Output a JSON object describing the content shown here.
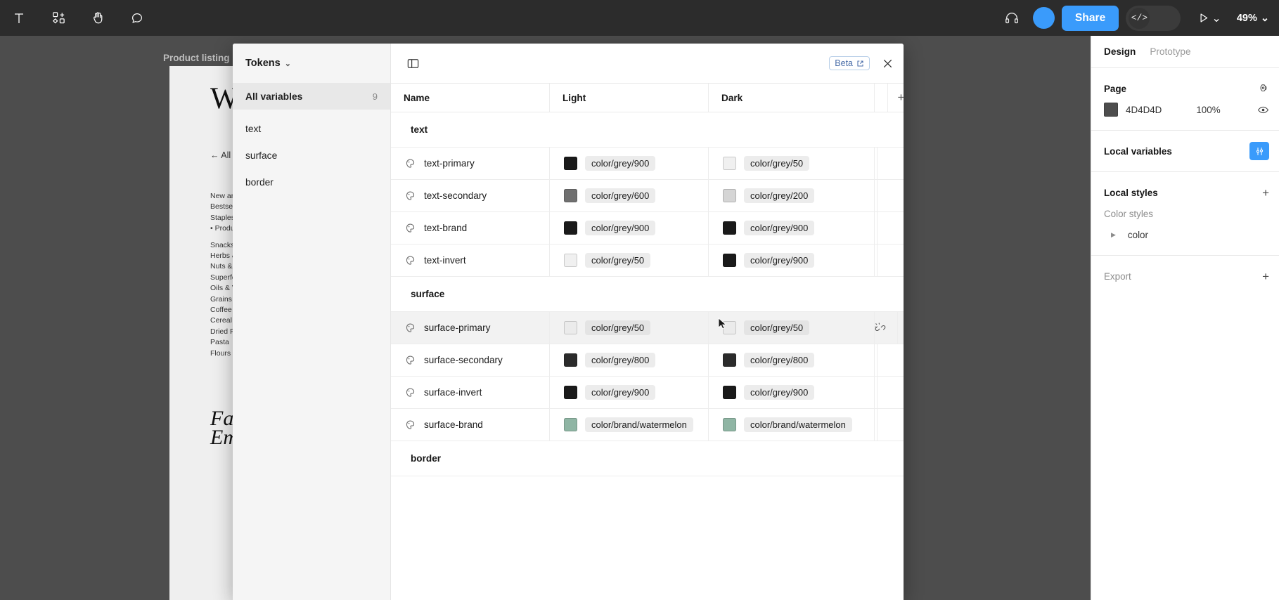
{
  "toolbar": {
    "left_tools": [
      {
        "name": "text-tool-icon",
        "glyph": "T"
      },
      {
        "name": "components-tool-icon",
        "glyph": "components"
      },
      {
        "name": "hand-tool-icon",
        "glyph": "hand"
      },
      {
        "name": "comment-tool-icon",
        "glyph": "comment"
      }
    ],
    "headset_icon": "headset-icon",
    "avatar": "user-avatar",
    "share_label": "Share",
    "devmode_label": "</>",
    "present_icon": "play-icon",
    "present_chevron": "⌄",
    "zoom_label": "49%",
    "zoom_chevron": "⌄"
  },
  "canvas": {
    "frame_label": "Product listing",
    "artboard": {
      "title": "Wo",
      "back_link": "← All p",
      "nav_items": [
        "New arriv",
        "Bestselle",
        "Staples",
        "• Produc",
        "",
        "Snacks",
        "Herbs &",
        "Nuts & S",
        "Superfoo",
        "Oils & Vir",
        "Grains",
        "Coffee &",
        "Cereal",
        "Dried Fru",
        "Pasta",
        "Flours & "
      ],
      "headline_line1": "Far",
      "headline_line2": "Em"
    }
  },
  "modal": {
    "header": {
      "collection_label": "Tokens",
      "collection_chevron": "⌄",
      "panel_toggle_icon": "panel-toggle-icon",
      "beta_label": "Beta",
      "beta_external_icon": "external-link-icon",
      "close_icon": "close-icon"
    },
    "rail": {
      "items": [
        {
          "label": "All variables",
          "count": "9",
          "active": true
        },
        {
          "label": "text",
          "count": "",
          "active": false
        },
        {
          "label": "surface",
          "count": "",
          "active": false
        },
        {
          "label": "border",
          "count": "",
          "active": false
        }
      ]
    },
    "table": {
      "columns": [
        "Name",
        "Light",
        "Dark"
      ],
      "add_column_label": "+",
      "groups": [
        {
          "name": "text",
          "rows": [
            {
              "icon": "variable-color-icon",
              "name": "text-primary",
              "light": {
                "swatch": "#1a1a1a",
                "value": "color/grey/900"
              },
              "dark": {
                "swatch": "#f0f0f0",
                "value": "color/grey/50"
              },
              "hover": false
            },
            {
              "icon": "variable-color-icon",
              "name": "text-secondary",
              "light": {
                "swatch": "#707070",
                "value": "color/grey/600"
              },
              "dark": {
                "swatch": "#d5d5d5",
                "value": "color/grey/200"
              },
              "hover": false
            },
            {
              "icon": "variable-color-icon",
              "name": "text-brand",
              "light": {
                "swatch": "#1a1a1a",
                "value": "color/grey/900"
              },
              "dark": {
                "swatch": "#1a1a1a",
                "value": "color/grey/900"
              },
              "hover": false
            },
            {
              "icon": "variable-color-icon",
              "name": "text-invert",
              "light": {
                "swatch": "#f0f0f0",
                "value": "color/grey/50"
              },
              "dark": {
                "swatch": "#1a1a1a",
                "value": "color/grey/900"
              },
              "hover": false
            }
          ]
        },
        {
          "name": "surface",
          "rows": [
            {
              "icon": "variable-color-icon",
              "name": "surface-primary",
              "light": {
                "swatch": "#ebebeb",
                "value": "color/grey/50"
              },
              "dark": {
                "swatch": "#ebebeb",
                "value": "color/grey/50"
              },
              "hover": true,
              "actions": [
                "unlink-icon",
                "sliders-icon"
              ]
            },
            {
              "icon": "variable-color-icon",
              "name": "surface-secondary",
              "light": {
                "swatch": "#2b2b2b",
                "value": "color/grey/800"
              },
              "dark": {
                "swatch": "#2b2b2b",
                "value": "color/grey/800"
              },
              "hover": false
            },
            {
              "icon": "variable-color-icon",
              "name": "surface-invert",
              "light": {
                "swatch": "#1a1a1a",
                "value": "color/grey/900"
              },
              "dark": {
                "swatch": "#1a1a1a",
                "value": "color/grey/900"
              },
              "hover": false
            },
            {
              "icon": "variable-color-icon",
              "name": "surface-brand",
              "light": {
                "swatch": "#8fb5a4",
                "value": "color/brand/watermelon"
              },
              "dark": {
                "swatch": "#8fb5a4",
                "value": "color/brand/watermelon"
              },
              "hover": false
            }
          ]
        },
        {
          "name": "border",
          "rows": []
        }
      ]
    }
  },
  "sidebar": {
    "tabs": [
      {
        "label": "Design",
        "active": true
      },
      {
        "label": "Prototype",
        "active": false
      }
    ],
    "page": {
      "title": "Page",
      "settings_icon": "page-settings-icon",
      "color_hex": "4D4D4D",
      "color_swatch": "#4d4d4d",
      "opacity": "100%",
      "visibility_icon": "eye-icon"
    },
    "local_variables": {
      "title": "Local variables",
      "open_icon": "sliders-icon"
    },
    "local_styles": {
      "title": "Local styles",
      "add_icon": "+",
      "subtitle": "Color styles",
      "groups": [
        {
          "label": "color",
          "expand_icon": "▶"
        }
      ]
    },
    "export": {
      "title": "Export",
      "add_icon": "+"
    }
  }
}
